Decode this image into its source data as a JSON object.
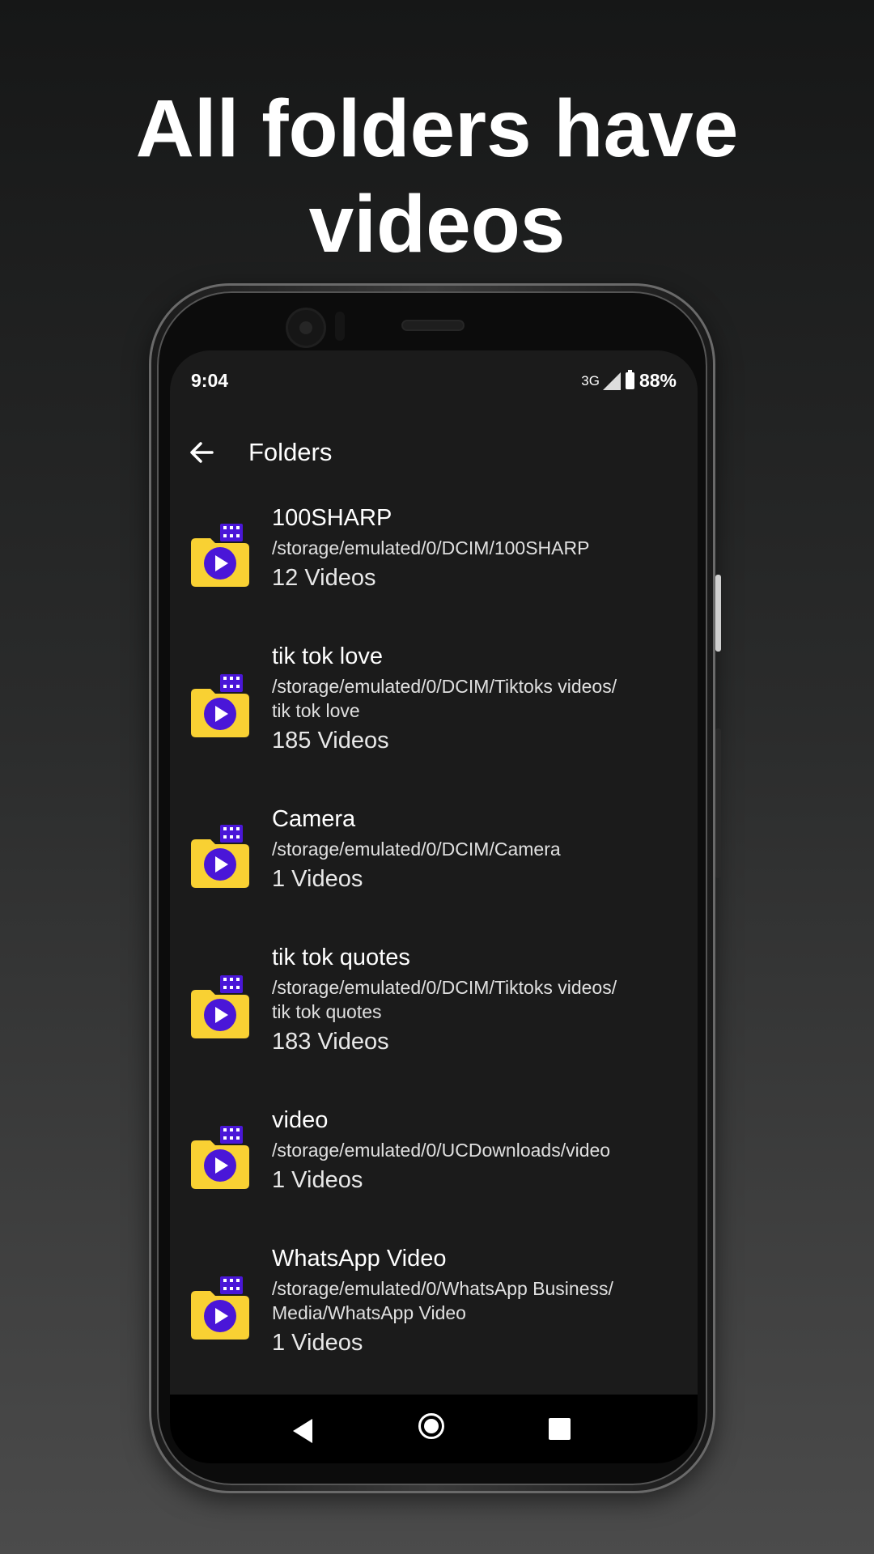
{
  "headline": {
    "line1": "All folders have",
    "line2": "videos"
  },
  "status_bar": {
    "time": "9:04",
    "network": "3G",
    "battery": "88%"
  },
  "app_bar": {
    "title": "Folders"
  },
  "folders": [
    {
      "name": "100SHARP",
      "path": "/storage/emulated/0/DCIM/100SHARP",
      "count": "12 Videos"
    },
    {
      "name": "tik tok love",
      "path": "/storage/emulated/0/DCIM/Tiktoks videos/",
      "path2": "tik tok love",
      "count": "185 Videos"
    },
    {
      "name": "Camera",
      "path": "/storage/emulated/0/DCIM/Camera",
      "count": "1 Videos"
    },
    {
      "name": "tik tok quotes",
      "path": "/storage/emulated/0/DCIM/Tiktoks videos/",
      "path2": "tik tok quotes",
      "count": "183 Videos"
    },
    {
      "name": "video",
      "path": "/storage/emulated/0/UCDownloads/video",
      "count": "1 Videos"
    },
    {
      "name": "WhatsApp Video",
      "path": "/storage/emulated/0/WhatsApp Business/",
      "path2": "Media/WhatsApp Video",
      "count": "1 Videos"
    }
  ],
  "colors": {
    "folder_yellow": "#f9d133",
    "play_purple": "#4a16d8"
  },
  "nav_icons": [
    "back-triangle-icon",
    "home-circle-icon",
    "recents-square-icon"
  ]
}
